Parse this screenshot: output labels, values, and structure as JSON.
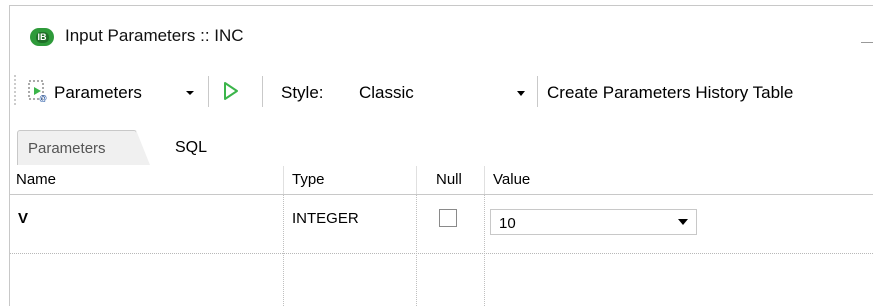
{
  "window": {
    "app_icon_label": "IB",
    "title": "Input Parameters :: INC"
  },
  "toolbar": {
    "parameters_label": "Parameters",
    "style_label": "Style:",
    "style_value": "Classic",
    "create_history_label": "Create Parameters History Table"
  },
  "tabs": [
    {
      "label": "Parameters",
      "active": true
    },
    {
      "label": "SQL",
      "active": false
    }
  ],
  "grid": {
    "columns": [
      "Name",
      "Type",
      "Null",
      "Value"
    ],
    "rows": [
      {
        "name": "V",
        "type": "INTEGER",
        "null": false,
        "value": "10"
      }
    ]
  },
  "colors": {
    "run_green": "#3bb54a",
    "app_green": "#2e9a3a"
  }
}
